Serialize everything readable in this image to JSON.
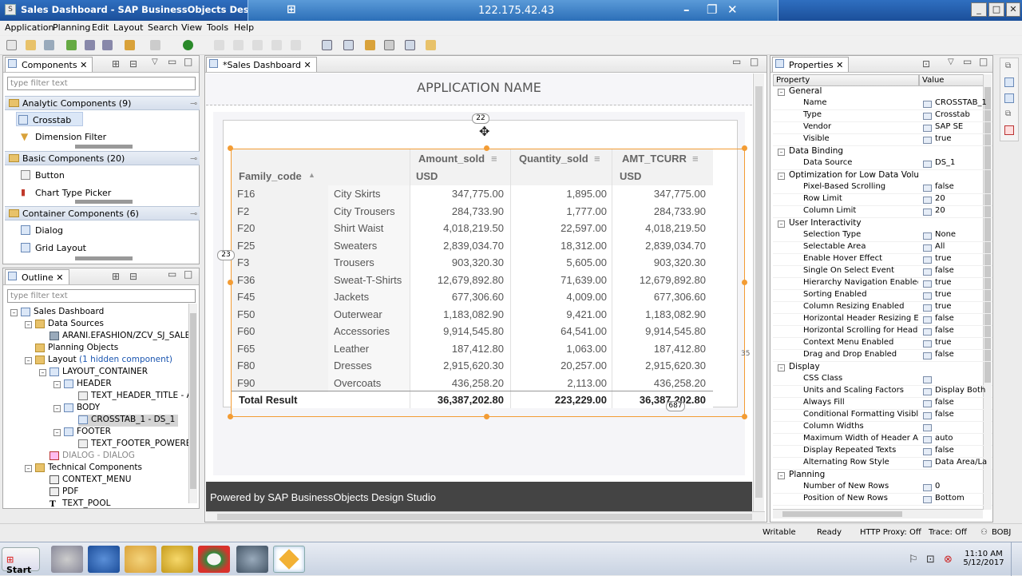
{
  "window": {
    "title": "Sales Dashboard - SAP BusinessObjects Design Studio",
    "remote_ip": "122.175.42.43"
  },
  "menu": [
    "Application",
    "Planning",
    "Edit",
    "Layout",
    "Search",
    "View",
    "Tools",
    "Help"
  ],
  "components_panel": {
    "tab": "Components",
    "filter_placeholder": "type filter text",
    "groups": [
      {
        "label": "Analytic Components (9)",
        "items": [
          "Crosstab",
          "Dimension Filter"
        ]
      },
      {
        "label": "Basic Components (20)",
        "items": [
          "Button",
          "Chart Type Picker"
        ]
      },
      {
        "label": "Container Components (6)",
        "items": [
          "Dialog",
          "Grid Layout"
        ]
      }
    ]
  },
  "outline_panel": {
    "tab": "Outline",
    "filter_placeholder": "type filter text",
    "tree": {
      "root": "Sales Dashboard",
      "data_sources": "Data Sources",
      "data_source_item": "ARANI.EFASHION/ZCV_SJ_SALES",
      "planning_objects": "Planning Objects",
      "layout": "Layout",
      "layout_note": "(1 hidden component)",
      "layout_container": "LAYOUT_CONTAINER",
      "header": "HEADER",
      "text_header": "TEXT_HEADER_TITLE - AP",
      "body": "BODY",
      "crosstab": "CROSSTAB_1 - DS_1",
      "footer": "FOOTER",
      "text_footer": "TEXT_FOOTER_POWERED",
      "dialog": "DIALOG - DIALOG",
      "technical": "Technical Components",
      "context_menu": "CONTEXT_MENU",
      "pdf": "PDF",
      "text_pool": "TEXT_POOL"
    }
  },
  "editor": {
    "tab": "*Sales Dashboard",
    "app_name": "APPLICATION NAME",
    "badge_top": "22",
    "badge_left": "23",
    "badge_right": "35",
    "badge_bottom": "687",
    "footer_text": "Powered by SAP BusinessObjects Design Studio"
  },
  "crosstab": {
    "row_header": "Family_code",
    "columns": [
      {
        "name": "Amount_sold",
        "unit": "USD"
      },
      {
        "name": "Quantity_sold",
        "unit": ""
      },
      {
        "name": "AMT_TCURR",
        "unit": "USD"
      }
    ],
    "rows": [
      {
        "code": "F16",
        "family": "City Skirts",
        "amount": "347,775.00",
        "qty": "1,895.00",
        "amt_tcurr": "347,775.00"
      },
      {
        "code": "F2",
        "family": "City Trousers",
        "amount": "284,733.90",
        "qty": "1,777.00",
        "amt_tcurr": "284,733.90"
      },
      {
        "code": "F20",
        "family": "Shirt Waist",
        "amount": "4,018,219.50",
        "qty": "22,597.00",
        "amt_tcurr": "4,018,219.50"
      },
      {
        "code": "F25",
        "family": "Sweaters",
        "amount": "2,839,034.70",
        "qty": "18,312.00",
        "amt_tcurr": "2,839,034.70"
      },
      {
        "code": "F3",
        "family": "Trousers",
        "amount": "903,320.30",
        "qty": "5,605.00",
        "amt_tcurr": "903,320.30"
      },
      {
        "code": "F36",
        "family": "Sweat-T-Shirts",
        "amount": "12,679,892.80",
        "qty": "71,639.00",
        "amt_tcurr": "12,679,892.80"
      },
      {
        "code": "F45",
        "family": "Jackets",
        "amount": "677,306.60",
        "qty": "4,009.00",
        "amt_tcurr": "677,306.60"
      },
      {
        "code": "F50",
        "family": "Outerwear",
        "amount": "1,183,082.90",
        "qty": "9,421.00",
        "amt_tcurr": "1,183,082.90"
      },
      {
        "code": "F60",
        "family": "Accessories",
        "amount": "9,914,545.80",
        "qty": "64,541.00",
        "amt_tcurr": "9,914,545.80"
      },
      {
        "code": "F65",
        "family": "Leather",
        "amount": "187,412.80",
        "qty": "1,063.00",
        "amt_tcurr": "187,412.80"
      },
      {
        "code": "F80",
        "family": "Dresses",
        "amount": "2,915,620.30",
        "qty": "20,257.00",
        "amt_tcurr": "2,915,620.30"
      },
      {
        "code": "F90",
        "family": "Overcoats",
        "amount": "436,258.20",
        "qty": "2,113.00",
        "amt_tcurr": "436,258.20"
      }
    ],
    "total": {
      "label": "Total Result",
      "amount": "36,387,202.80",
      "qty": "223,229.00",
      "amt_tcurr": "36,387,202.80"
    }
  },
  "properties_panel": {
    "tab": "Properties",
    "col_property": "Property",
    "col_value": "Value",
    "rows": [
      {
        "cat": true,
        "k": "General",
        "v": ""
      },
      {
        "k": "Name",
        "v": "CROSSTAB_1"
      },
      {
        "k": "Type",
        "v": "Crosstab"
      },
      {
        "k": "Vendor",
        "v": "SAP SE"
      },
      {
        "k": "Visible",
        "v": "true"
      },
      {
        "cat": true,
        "k": "Data Binding",
        "v": ""
      },
      {
        "k": "Data Source",
        "v": "DS_1"
      },
      {
        "cat": true,
        "k": "Optimization for Low Data Volume",
        "v": ""
      },
      {
        "k": "Pixel-Based Scrolling",
        "v": "false"
      },
      {
        "k": "Row Limit",
        "v": "20"
      },
      {
        "k": "Column Limit",
        "v": "20"
      },
      {
        "cat": true,
        "k": "User Interactivity",
        "v": ""
      },
      {
        "k": "Selection Type",
        "v": "None"
      },
      {
        "k": "Selectable Area",
        "v": "All"
      },
      {
        "k": "Enable Hover Effect",
        "v": "true"
      },
      {
        "k": "Single On Select Event",
        "v": "false"
      },
      {
        "k": "Hierarchy Navigation Enabled",
        "v": "true"
      },
      {
        "k": "Sorting Enabled",
        "v": "true"
      },
      {
        "k": "Column Resizing Enabled",
        "v": "true"
      },
      {
        "k": "Horizontal Header Resizing Enab",
        "v": "false"
      },
      {
        "k": "Horizontal Scrolling for Header E",
        "v": "false"
      },
      {
        "k": "Context Menu Enabled",
        "v": "true"
      },
      {
        "k": "Drag and Drop Enabled",
        "v": "false"
      },
      {
        "cat": true,
        "k": "Display",
        "v": ""
      },
      {
        "k": "CSS Class",
        "v": ""
      },
      {
        "k": "Units and Scaling Factors",
        "v": "Display Both i"
      },
      {
        "k": "Always Fill",
        "v": "false"
      },
      {
        "k": "Conditional Formatting Visible",
        "v": "false"
      },
      {
        "k": "Column Widths",
        "v": ""
      },
      {
        "k": "Maximum Width of Header Area",
        "v": "auto"
      },
      {
        "k": "Display Repeated Texts",
        "v": "false"
      },
      {
        "k": "Alternating Row Style",
        "v": "Data Area/La"
      },
      {
        "cat": true,
        "k": "Planning",
        "v": ""
      },
      {
        "k": "Number of New Rows",
        "v": "0"
      },
      {
        "k": "Position of New Rows",
        "v": "Bottom"
      }
    ]
  },
  "status_bar": {
    "writable": "Writable",
    "ready": "Ready",
    "proxy": "HTTP Proxy: Off",
    "trace": "Trace: Off",
    "user": "BOBJ"
  },
  "taskbar": {
    "start": "Start",
    "time": "11:10 AM",
    "date": "5/12/2017"
  }
}
